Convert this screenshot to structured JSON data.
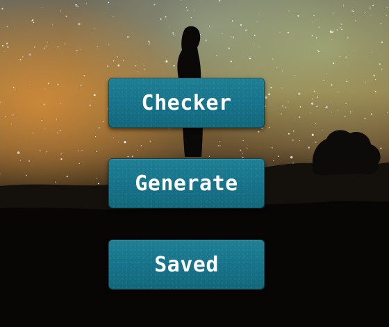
{
  "menu": {
    "buttons": [
      {
        "label": "Checker"
      },
      {
        "label": "Generate"
      },
      {
        "label": "Saved"
      }
    ]
  },
  "background": {
    "description_icon": "night-sky-photo",
    "accent_color": "#16728a"
  }
}
